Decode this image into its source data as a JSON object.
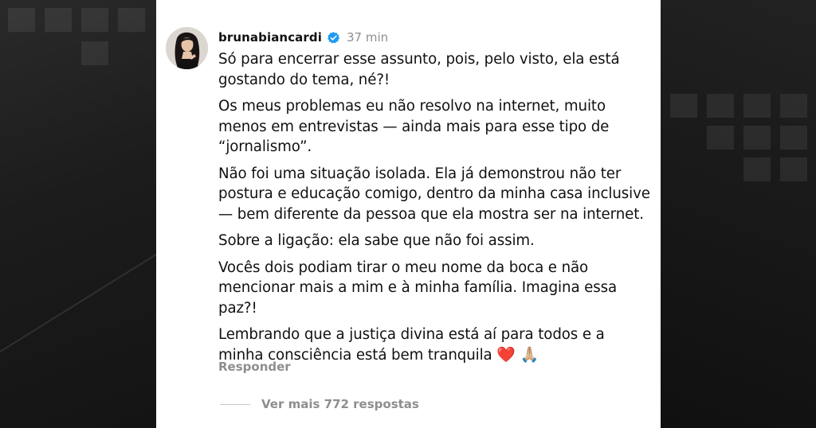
{
  "comment": {
    "username": "brunabiancardi",
    "time": "37 min",
    "paragraphs": [
      "Só para encerrar esse assunto, pois, pelo visto, ela está gostando do tema, né?!",
      "Os meus problemas eu não resolvo na internet, muito menos em entrevistas — ainda mais para esse tipo de “jornalismo”.",
      "Não foi uma situação isolada. Ela já demonstrou não ter postura e educação comigo, dentro da minha casa inclusive — bem diferente da pessoa que ela mostra ser na internet.",
      "Sobre a ligação: ela sabe que não foi assim.",
      "Vocês dois podiam tirar o meu nome da boca e não mencionar mais a mim e à minha família. Imagina essa paz?!"
    ],
    "last_paragraph": "Lembrando que a justiça divina está aí para todos e a minha consciência está bem tranquila",
    "emojis": "❤️ 🙏🏼",
    "reply_label": "Responder",
    "view_replies_label": "Ver mais 772 respostas"
  },
  "icons": {
    "verified": "verified-badge-icon",
    "avatar": "profile-photo"
  },
  "colors": {
    "verified_blue": "#1d9bf0",
    "muted_text": "#8e8e8e",
    "card_bg": "#ffffff",
    "backdrop": "#111111"
  }
}
